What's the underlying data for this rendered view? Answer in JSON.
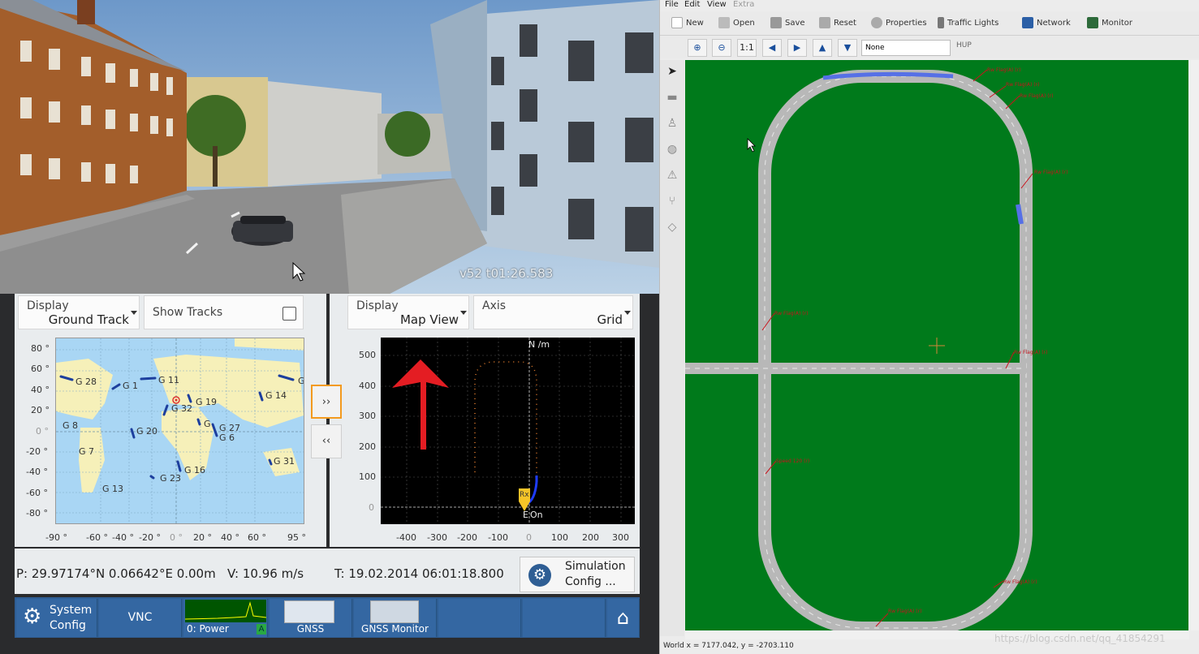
{
  "scene": {
    "time_readout": "v52 t01:26.583"
  },
  "gnss_panel": {
    "left_display": {
      "label": "Display",
      "value": "Ground Track"
    },
    "show_tracks": {
      "label": "Show Tracks",
      "checked": false
    },
    "right_display": {
      "label": "Display",
      "value": "Map View"
    },
    "axis": {
      "label": "Axis",
      "value": "Grid"
    },
    "world_map": {
      "lat_ticks": [
        "80 °",
        "60 °",
        "40 °",
        "20 °",
        "0 °",
        "-20 °",
        "-40 °",
        "-60 °",
        "-80 °"
      ],
      "lon_ticks": [
        "-90 °",
        "-60 °",
        "-40 °",
        "-20 °",
        "0 °",
        "20 °",
        "40 °",
        "60 °",
        "95 °"
      ],
      "satellites": [
        "G 28",
        "G 1",
        "G 11",
        "G 32",
        "G 19",
        "G 14",
        "G 8",
        "G 20",
        "G 27",
        "G 6",
        "G 7",
        "G 16",
        "G 23",
        "G 31",
        "G 13",
        "G",
        "G"
      ]
    },
    "forward_button": "››",
    "back_button": "‹‹",
    "map_view": {
      "y_ticks": [
        "500",
        "400",
        "300",
        "200",
        "100",
        "0"
      ],
      "x_ticks": [
        "-400",
        "-300",
        "-200",
        "-100",
        "0",
        "100",
        "200",
        "300"
      ],
      "north_label": "N /m",
      "east_label": "E",
      "on_label": "On",
      "marker_label": "Rx"
    },
    "status": {
      "position": "P: 29.97174°N 0.06642°E 0.00m",
      "velocity": "V: 10.96 m/s",
      "time": "T: 19.02.2014 06:01:18.800"
    },
    "sim_config": {
      "line1": "Simulation",
      "line2": "Config ..."
    },
    "taskbar": {
      "system_config": {
        "line1": "System",
        "line2": "Config"
      },
      "vnc": "VNC",
      "power": "0: Power",
      "power_badge": "A",
      "gnss": "GNSS",
      "gnss_monitor": "GNSS Monitor"
    }
  },
  "editor": {
    "menu": [
      "File",
      "Edit",
      "View",
      "Extra"
    ],
    "toolbar": [
      "New",
      "Open",
      "Save",
      "Reset",
      "Properties",
      "Traffic Lights",
      "Network",
      "Monitor"
    ],
    "zoom_buttons": [
      "⊕",
      "⊖",
      "1:1",
      "◀",
      "▶",
      "▲",
      "▼"
    ],
    "layer_select": "None",
    "hud": "HUP",
    "status": "World x = 7177.042, y = -2703.110",
    "watermark": "https://blog.csdn.net/qq_41854291"
  },
  "colors": {
    "map_green": "#007a1b",
    "road_gray": "#b8b8b8",
    "taskbar_blue": "#2f5e94",
    "accent_orange": "#f39a1e"
  }
}
